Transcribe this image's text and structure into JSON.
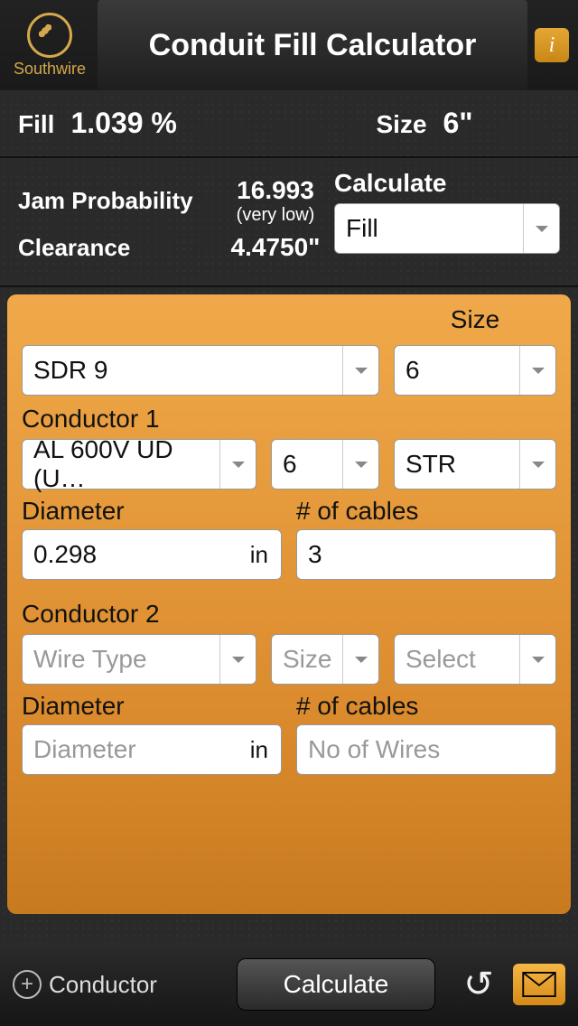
{
  "header": {
    "brand": "Southwire",
    "title": "Conduit Fill Calculator"
  },
  "results": {
    "fill_label": "Fill",
    "fill_value": "1.039 %",
    "size_label": "Size",
    "size_value": "6\"",
    "jam_label": "Jam Probability",
    "jam_value": "16.993",
    "jam_qual": "(very low)",
    "clearance_label": "Clearance",
    "clearance_value": "4.4750\"",
    "calc_label": "Calculate",
    "calc_mode": "Fill"
  },
  "panel": {
    "size_header": "Size",
    "conduit_type": "SDR 9",
    "conduit_size": "6",
    "conductors": [
      {
        "title": "Conductor 1",
        "wire_type": "AL 600V UD (U…",
        "size": "6",
        "strand": "STR",
        "diameter_label": "Diameter",
        "diameter_value": "0.298",
        "diameter_unit": "in",
        "ncables_label": "# of cables",
        "ncables_value": "3"
      },
      {
        "title": "Conductor 2",
        "wire_type_placeholder": "Wire Type",
        "size_placeholder": "Size",
        "strand_placeholder": "Select",
        "diameter_label": "Diameter",
        "diameter_placeholder": "Diameter",
        "diameter_unit": "in",
        "ncables_label": "# of cables",
        "ncables_placeholder": "No of Wires"
      }
    ]
  },
  "bottom": {
    "add_label": "Conductor",
    "calculate": "Calculate"
  }
}
